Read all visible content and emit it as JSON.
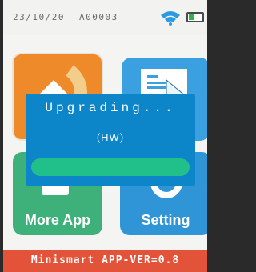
{
  "status_bar": {
    "date": "23/10/20",
    "device_id": "A00003"
  },
  "tiles": [
    {
      "label": "",
      "icon": "upgrade-icon",
      "color": "#ee8a2a"
    },
    {
      "label": "",
      "icon": "document-icon",
      "color": "#3aa0e0"
    },
    {
      "label": "More App",
      "icon": "apps-icon",
      "color": "#3eb07a"
    },
    {
      "label": "Setting",
      "icon": "gear-icon",
      "color": "#2f95d6"
    }
  ],
  "dialog": {
    "title": "Upgrading...",
    "subtitle": "(HW)",
    "progress": 1.0
  },
  "footer": {
    "version": "Minismart APP-VER=0.8"
  },
  "colors": {
    "accent_blue": "#0c85c9",
    "footer": "#e2533a",
    "progress": "#21c08a"
  }
}
